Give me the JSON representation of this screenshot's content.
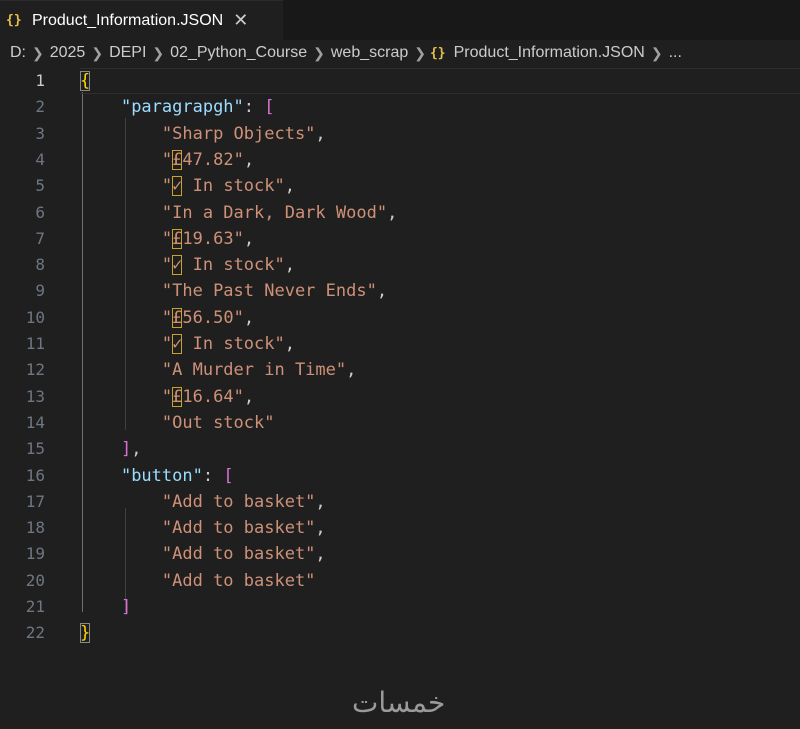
{
  "tab": {
    "icon_glyph": "{}",
    "icon": "json-braces-icon",
    "label": "Product_Information.JSON",
    "close_glyph": "✕"
  },
  "breadcrumb": {
    "items": [
      "D:",
      "2025",
      "DEPI",
      "02_Python_Course",
      "web_scrap"
    ],
    "file_icon_glyph": "{}",
    "file": "Product_Information.JSON",
    "ellipsis": "..."
  },
  "editor": {
    "active_line": 1,
    "lines": [
      {
        "n": "1",
        "parts": [
          {
            "t": "{",
            "c": "brace matched"
          }
        ]
      },
      {
        "n": "2",
        "parts": [
          {
            "t": "    "
          },
          {
            "t": "\"paragrapgh\"",
            "c": "key"
          },
          {
            "t": ": ",
            "c": "punct"
          },
          {
            "t": "[",
            "c": "bracket"
          }
        ]
      },
      {
        "n": "3",
        "parts": [
          {
            "t": "        "
          },
          {
            "t": "\"Sharp Objects\"",
            "c": "str"
          },
          {
            "t": ",",
            "c": "punct"
          }
        ]
      },
      {
        "n": "4",
        "parts": [
          {
            "t": "        "
          },
          {
            "t": "\"",
            "c": "str"
          },
          {
            "t": "£",
            "c": "str uni-box"
          },
          {
            "t": "47.82\"",
            "c": "str"
          },
          {
            "t": ",",
            "c": "punct"
          }
        ]
      },
      {
        "n": "5",
        "parts": [
          {
            "t": "        "
          },
          {
            "t": "\"",
            "c": "str"
          },
          {
            "t": "✓",
            "c": "str uni-box"
          },
          {
            "t": " In stock\"",
            "c": "str"
          },
          {
            "t": ",",
            "c": "punct"
          }
        ]
      },
      {
        "n": "6",
        "parts": [
          {
            "t": "        "
          },
          {
            "t": "\"In a Dark, Dark Wood\"",
            "c": "str"
          },
          {
            "t": ",",
            "c": "punct"
          }
        ]
      },
      {
        "n": "7",
        "parts": [
          {
            "t": "        "
          },
          {
            "t": "\"",
            "c": "str"
          },
          {
            "t": "£",
            "c": "str uni-box"
          },
          {
            "t": "19.63\"",
            "c": "str"
          },
          {
            "t": ",",
            "c": "punct"
          }
        ]
      },
      {
        "n": "8",
        "parts": [
          {
            "t": "        "
          },
          {
            "t": "\"",
            "c": "str"
          },
          {
            "t": "✓",
            "c": "str uni-box"
          },
          {
            "t": " In stock\"",
            "c": "str"
          },
          {
            "t": ",",
            "c": "punct"
          }
        ]
      },
      {
        "n": "9",
        "parts": [
          {
            "t": "        "
          },
          {
            "t": "\"The Past Never Ends\"",
            "c": "str"
          },
          {
            "t": ",",
            "c": "punct"
          }
        ]
      },
      {
        "n": "10",
        "parts": [
          {
            "t": "        "
          },
          {
            "t": "\"",
            "c": "str"
          },
          {
            "t": "£",
            "c": "str uni-box"
          },
          {
            "t": "56.50\"",
            "c": "str"
          },
          {
            "t": ",",
            "c": "punct"
          }
        ]
      },
      {
        "n": "11",
        "parts": [
          {
            "t": "        "
          },
          {
            "t": "\"",
            "c": "str"
          },
          {
            "t": "✓",
            "c": "str uni-box"
          },
          {
            "t": " In stock\"",
            "c": "str"
          },
          {
            "t": ",",
            "c": "punct"
          }
        ]
      },
      {
        "n": "12",
        "parts": [
          {
            "t": "        "
          },
          {
            "t": "\"A Murder in Time\"",
            "c": "str"
          },
          {
            "t": ",",
            "c": "punct"
          }
        ]
      },
      {
        "n": "13",
        "parts": [
          {
            "t": "        "
          },
          {
            "t": "\"",
            "c": "str"
          },
          {
            "t": "£",
            "c": "str uni-box"
          },
          {
            "t": "16.64\"",
            "c": "str"
          },
          {
            "t": ",",
            "c": "punct"
          }
        ]
      },
      {
        "n": "14",
        "parts": [
          {
            "t": "        "
          },
          {
            "t": "\"Out stock\"",
            "c": "str"
          }
        ]
      },
      {
        "n": "15",
        "parts": [
          {
            "t": "    "
          },
          {
            "t": "]",
            "c": "bracket"
          },
          {
            "t": ",",
            "c": "punct"
          }
        ]
      },
      {
        "n": "16",
        "parts": [
          {
            "t": "    "
          },
          {
            "t": "\"button\"",
            "c": "key"
          },
          {
            "t": ": ",
            "c": "punct"
          },
          {
            "t": "[",
            "c": "bracket"
          }
        ]
      },
      {
        "n": "17",
        "parts": [
          {
            "t": "        "
          },
          {
            "t": "\"Add to basket\"",
            "c": "str"
          },
          {
            "t": ",",
            "c": "punct"
          }
        ]
      },
      {
        "n": "18",
        "parts": [
          {
            "t": "        "
          },
          {
            "t": "\"Add to basket\"",
            "c": "str"
          },
          {
            "t": ",",
            "c": "punct"
          }
        ]
      },
      {
        "n": "19",
        "parts": [
          {
            "t": "        "
          },
          {
            "t": "\"Add to basket\"",
            "c": "str"
          },
          {
            "t": ",",
            "c": "punct"
          }
        ]
      },
      {
        "n": "20",
        "parts": [
          {
            "t": "        "
          },
          {
            "t": "\"Add to basket\"",
            "c": "str"
          }
        ]
      },
      {
        "n": "21",
        "parts": [
          {
            "t": "    "
          },
          {
            "t": "]",
            "c": "bracket"
          }
        ]
      },
      {
        "n": "22",
        "parts": [
          {
            "t": "}",
            "c": "brace matched"
          }
        ]
      }
    ]
  },
  "watermark": {
    "text": "خمسات"
  },
  "colors": {
    "string": "#ce9178",
    "key": "#9cdcfe",
    "brace": "#ffd700",
    "bracket": "#da70d6",
    "json_icon": "#e8c14a"
  }
}
